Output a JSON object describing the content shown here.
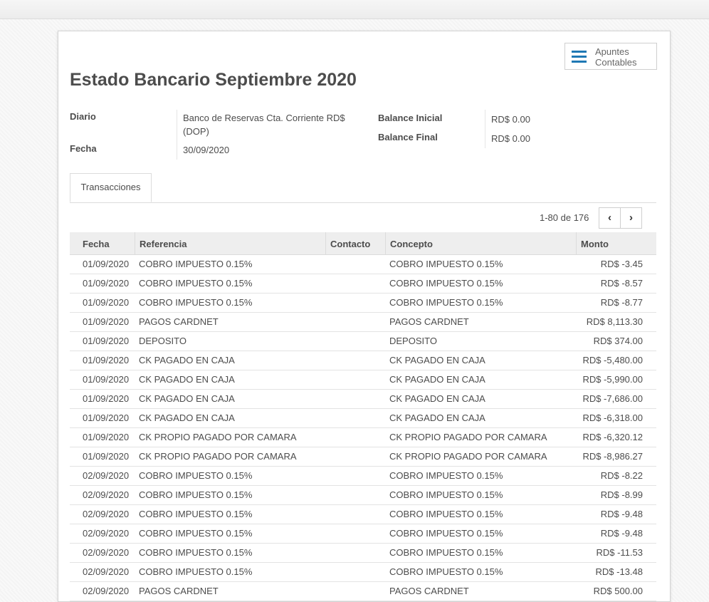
{
  "smart_button": {
    "label": "Apuntes\nContables",
    "icon": "hamburger-list-icon"
  },
  "title": "Estado Bancario Septiembre 2020",
  "fields": {
    "diario_label": "Diario",
    "diario_value": "Banco de Reservas Cta. Corriente RD$ (DOP)",
    "fecha_label": "Fecha",
    "fecha_value": "30/09/2020",
    "balance_inicial_label": "Balance Inicial",
    "balance_inicial_value": "RD$ 0.00",
    "balance_final_label": "Balance Final",
    "balance_final_value": "RD$ 0.00"
  },
  "tabs": [
    {
      "label": "Transacciones",
      "active": true
    }
  ],
  "pager": {
    "value": "1-80 de 176",
    "prev_icon": "chevron-left-icon",
    "next_icon": "chevron-right-icon"
  },
  "columns": {
    "fecha": "Fecha",
    "referencia": "Referencia",
    "contacto": "Contacto",
    "concepto": "Concepto",
    "monto": "Monto"
  },
  "rows": [
    {
      "fecha": "01/09/2020",
      "referencia": "COBRO IMPUESTO 0.15%",
      "contacto": "",
      "concepto": "COBRO IMPUESTO 0.15%",
      "monto": "RD$ -3.45"
    },
    {
      "fecha": "01/09/2020",
      "referencia": "COBRO IMPUESTO 0.15%",
      "contacto": "",
      "concepto": "COBRO IMPUESTO 0.15%",
      "monto": "RD$ -8.57"
    },
    {
      "fecha": "01/09/2020",
      "referencia": "COBRO IMPUESTO 0.15%",
      "contacto": "",
      "concepto": "COBRO IMPUESTO 0.15%",
      "monto": "RD$ -8.77"
    },
    {
      "fecha": "01/09/2020",
      "referencia": "PAGOS CARDNET",
      "contacto": "",
      "concepto": "PAGOS CARDNET",
      "monto": "RD$ 8,113.30"
    },
    {
      "fecha": "01/09/2020",
      "referencia": "DEPOSITO",
      "contacto": "",
      "concepto": "DEPOSITO",
      "monto": "RD$ 374.00"
    },
    {
      "fecha": "01/09/2020",
      "referencia": "CK PAGADO EN CAJA",
      "contacto": "",
      "concepto": "CK PAGADO EN CAJA",
      "monto": "RD$ -5,480.00"
    },
    {
      "fecha": "01/09/2020",
      "referencia": "CK PAGADO EN CAJA",
      "contacto": "",
      "concepto": "CK PAGADO EN CAJA",
      "monto": "RD$ -5,990.00"
    },
    {
      "fecha": "01/09/2020",
      "referencia": "CK PAGADO EN CAJA",
      "contacto": "",
      "concepto": "CK PAGADO EN CAJA",
      "monto": "RD$ -7,686.00"
    },
    {
      "fecha": "01/09/2020",
      "referencia": "CK PAGADO EN CAJA",
      "contacto": "",
      "concepto": "CK PAGADO EN CAJA",
      "monto": "RD$ -6,318.00"
    },
    {
      "fecha": "01/09/2020",
      "referencia": "CK PROPIO PAGADO POR CAMARA",
      "contacto": "",
      "concepto": "CK PROPIO PAGADO POR CAMARA",
      "monto": "RD$ -6,320.12"
    },
    {
      "fecha": "01/09/2020",
      "referencia": "CK PROPIO PAGADO POR CAMARA",
      "contacto": "",
      "concepto": "CK PROPIO PAGADO POR CAMARA",
      "monto": "RD$ -8,986.27"
    },
    {
      "fecha": "02/09/2020",
      "referencia": "COBRO IMPUESTO 0.15%",
      "contacto": "",
      "concepto": "COBRO IMPUESTO 0.15%",
      "monto": "RD$ -8.22"
    },
    {
      "fecha": "02/09/2020",
      "referencia": "COBRO IMPUESTO 0.15%",
      "contacto": "",
      "concepto": "COBRO IMPUESTO 0.15%",
      "monto": "RD$ -8.99"
    },
    {
      "fecha": "02/09/2020",
      "referencia": "COBRO IMPUESTO 0.15%",
      "contacto": "",
      "concepto": "COBRO IMPUESTO 0.15%",
      "monto": "RD$ -9.48"
    },
    {
      "fecha": "02/09/2020",
      "referencia": "COBRO IMPUESTO 0.15%",
      "contacto": "",
      "concepto": "COBRO IMPUESTO 0.15%",
      "monto": "RD$ -9.48"
    },
    {
      "fecha": "02/09/2020",
      "referencia": "COBRO IMPUESTO 0.15%",
      "contacto": "",
      "concepto": "COBRO IMPUESTO 0.15%",
      "monto": "RD$ -11.53"
    },
    {
      "fecha": "02/09/2020",
      "referencia": "COBRO IMPUESTO 0.15%",
      "contacto": "",
      "concepto": "COBRO IMPUESTO 0.15%",
      "monto": "RD$ -13.48"
    },
    {
      "fecha": "02/09/2020",
      "referencia": "PAGOS CARDNET",
      "contacto": "",
      "concepto": "PAGOS CARDNET",
      "monto": "RD$ 500.00"
    }
  ]
}
